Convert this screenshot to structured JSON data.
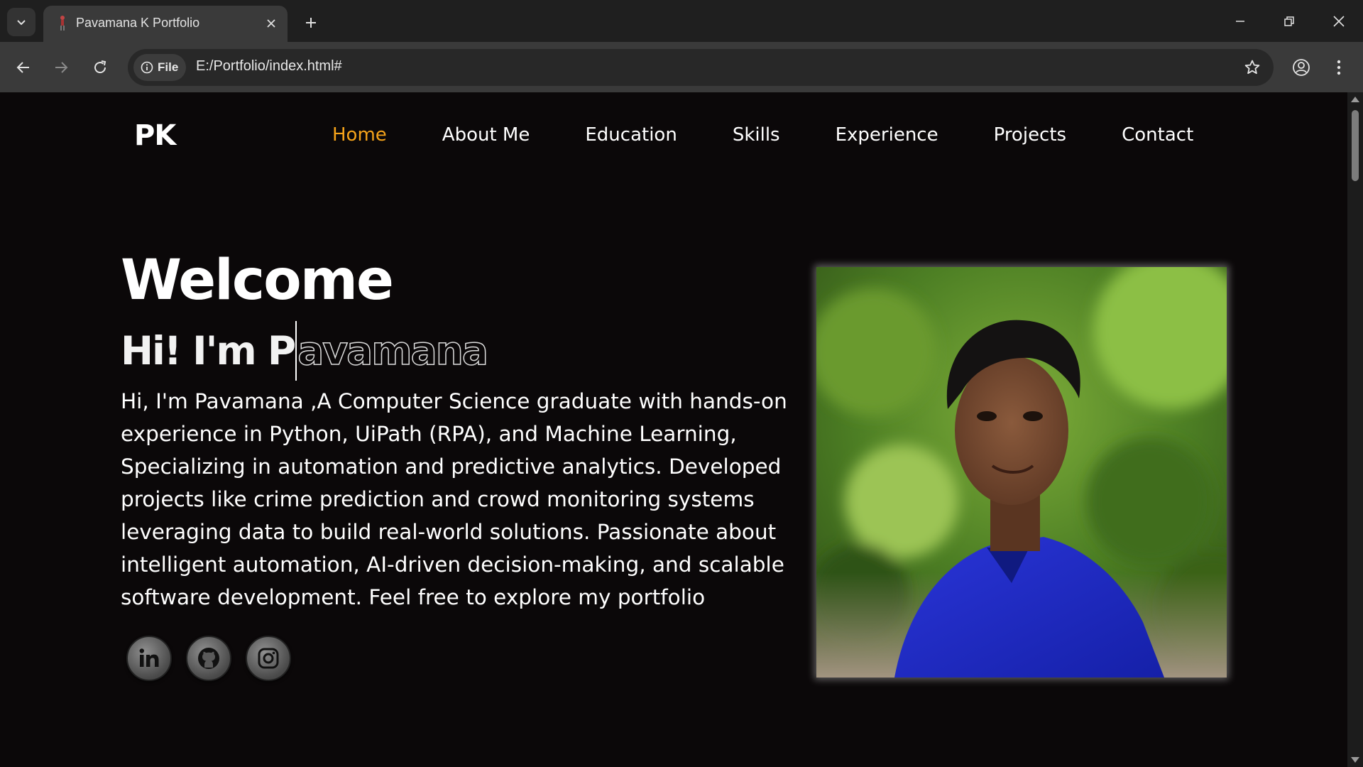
{
  "browser": {
    "tab_title": "Pavamana K Portfolio",
    "site_chip_label": "File",
    "url": "E:/Portfolio/index.html#"
  },
  "page": {
    "logo": "PK",
    "nav": [
      {
        "label": "Home",
        "active": true
      },
      {
        "label": "About Me",
        "active": false
      },
      {
        "label": "Education",
        "active": false
      },
      {
        "label": "Skills",
        "active": false
      },
      {
        "label": "Experience",
        "active": false
      },
      {
        "label": "Projects",
        "active": false
      },
      {
        "label": "Contact",
        "active": false
      }
    ],
    "welcome": "Welcome",
    "greeting_typed": "Hi! I'm P",
    "greeting_pending": "avamana",
    "bio": "Hi, I'm Pavamana ,A Computer Science graduate with hands-on experience in Python, UiPath (RPA), and Machine Learning, Specializing in automation and predictive analytics. Developed projects like crime prediction and crowd monitoring systems leveraging data to build real-world solutions. Passionate about intelligent automation, AI-driven decision-making, and scalable software development. Feel free to explore my portfolio",
    "socials": [
      "linkedin-icon",
      "github-icon",
      "instagram-icon"
    ],
    "accent_color": "#f5a31a",
    "background_color": "#0b0809"
  }
}
